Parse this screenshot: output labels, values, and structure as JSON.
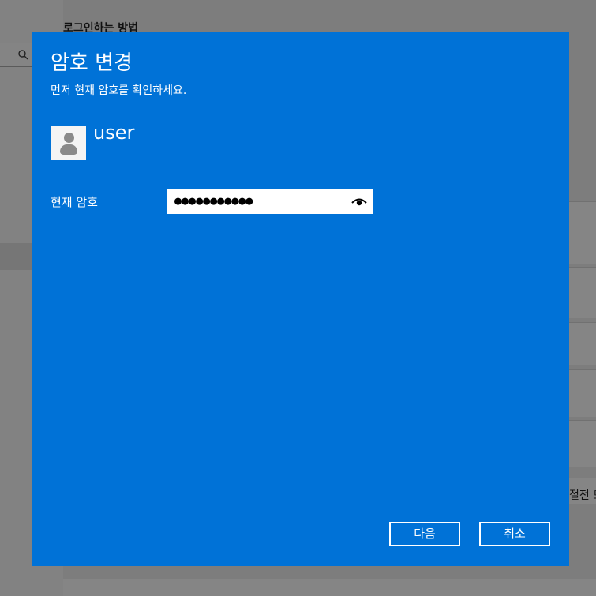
{
  "background": {
    "title": "로그인하는 방법",
    "card_text": "절전 모"
  },
  "dialog": {
    "title": "암호 변경",
    "subtitle": "먼저 현재 암호를 확인하세요.",
    "username": "user",
    "password_label": "현재 암호",
    "password_value": "●●●●●●●●●●●",
    "next_button": "다음",
    "cancel_button": "취소",
    "accent_color": "#0072d7"
  },
  "icons": {
    "avatar": "user-avatar-icon",
    "reveal": "eye-icon",
    "search": "search-icon"
  }
}
